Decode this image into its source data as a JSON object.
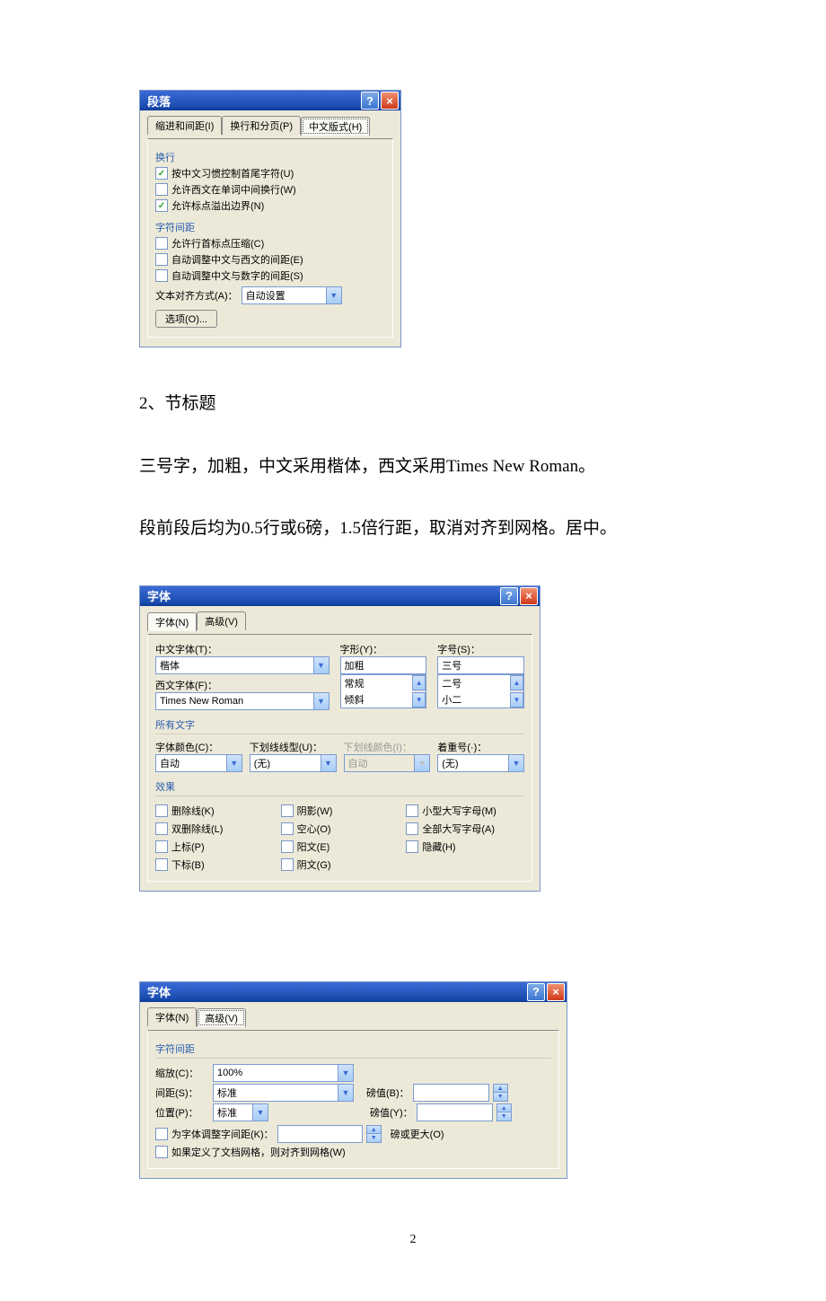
{
  "dialog1": {
    "title": "段落",
    "tabs": {
      "indent": "缩进和间距(I)",
      "paging": "换行和分页(P)",
      "cjk": "中文版式(H)"
    },
    "sec_wrap": "换行",
    "cb1": "按中文习惯控制首尾字符(U)",
    "cb2": "允许西文在单词中间换行(W)",
    "cb3": "允许标点溢出边界(N)",
    "sec_charspacing": "字符间距",
    "cb4": "允许行首标点压缩(C)",
    "cb5": "自动调整中文与西文的间距(E)",
    "cb6": "自动调整中文与数字的间距(S)",
    "align_label": "文本对齐方式(A)：",
    "align_value": "自动设置",
    "options_btn": "选项(O)..."
  },
  "text": {
    "heading": "2、节标题",
    "p1": "三号字，加粗，中文采用楷体，西文采用Times  New  Roman。",
    "p2": "段前段后均为0.5行或6磅，1.5倍行距，取消对齐到网格。居中。"
  },
  "dialog2": {
    "title": "字体",
    "tab_font": "字体(N)",
    "tab_adv": "高级(V)",
    "lbl_cn": "中文字体(T)：",
    "val_cn": "楷体",
    "lbl_en": "西文字体(F)：",
    "val_en": "Times New Roman",
    "lbl_style": "字形(Y)：",
    "val_style": "加粗",
    "style_items": {
      "a": "常规",
      "b": "倾斜",
      "c": "加粗"
    },
    "lbl_size": "字号(S)：",
    "val_size": "三号",
    "size_items": {
      "a": "二号",
      "b": "小二",
      "c": "三号"
    },
    "sec_allchars": "所有文字",
    "lbl_color": "字体颜色(C)：",
    "val_color": "自动",
    "lbl_ultype": "下划线线型(U)：",
    "val_ultype": "(无)",
    "lbl_ulcolor": "下划线颜色(I)：",
    "val_ulcolor": "自动",
    "lbl_emph": "着重号(·)：",
    "val_emph": "(无)",
    "sec_effects": "效果",
    "eff": {
      "strike": "删除线(K)",
      "dstrike": "双删除线(L)",
      "super": "上标(P)",
      "sub": "下标(B)",
      "shadow": "阴影(W)",
      "hollow": "空心(O)",
      "emboss": "阳文(E)",
      "engrave": "阴文(G)",
      "smallcaps": "小型大写字母(M)",
      "allcaps": "全部大写字母(A)",
      "hidden": "隐藏(H)"
    }
  },
  "dialog3": {
    "title": "字体",
    "tab_font": "字体(N)",
    "tab_adv": "高级(V)",
    "sec": "字符间距",
    "lbl_scale": "缩放(C)：",
    "val_scale": "100%",
    "lbl_spacing": "间距(S)：",
    "val_spacing": "标准",
    "lbl_pos": "位置(P)：",
    "val_pos": "标准",
    "lbl_by_b": "磅值(B)：",
    "lbl_by_y": "磅值(Y)：",
    "cb_kern": "为字体调整字间距(K)：",
    "kern_suffix": "磅或更大(O)",
    "cb_grid": "如果定义了文档网格，则对齐到网格(W)"
  },
  "page_number": "2"
}
